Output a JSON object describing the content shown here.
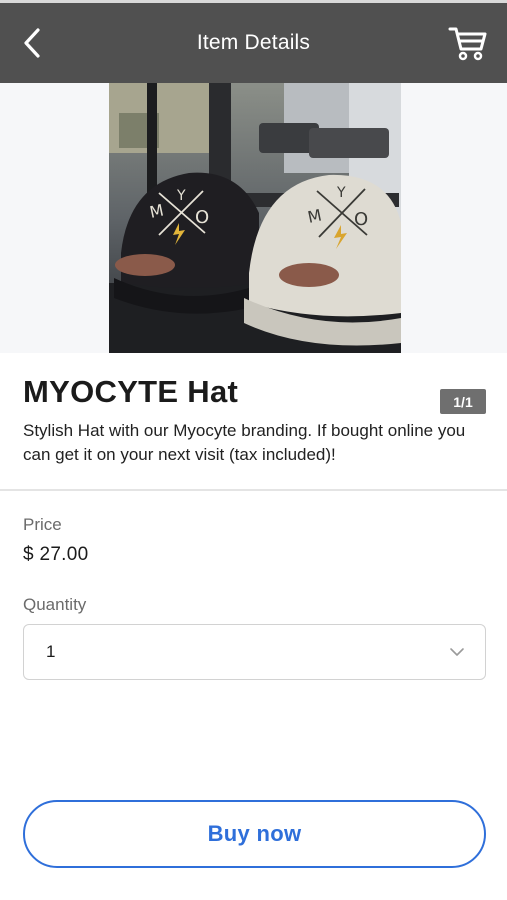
{
  "header": {
    "title": "Item Details",
    "back_icon": "chevron-left-icon",
    "cart_icon": "shopping-cart-icon"
  },
  "gallery": {
    "counter": "1/1",
    "image_letters": "MYO"
  },
  "product": {
    "name": "MYOCYTE Hat",
    "description": "Stylish Hat with our Myocyte branding. If bought online you can get it on your next visit (tax included)!"
  },
  "price": {
    "label": "Price",
    "value": "$ 27.00"
  },
  "quantity": {
    "label": "Quantity",
    "value": "1",
    "dropdown_icon": "chevron-down-icon"
  },
  "actions": {
    "buy_label": "Buy now"
  },
  "colors": {
    "header_bg": "#505050",
    "accent": "#2f6fda"
  }
}
